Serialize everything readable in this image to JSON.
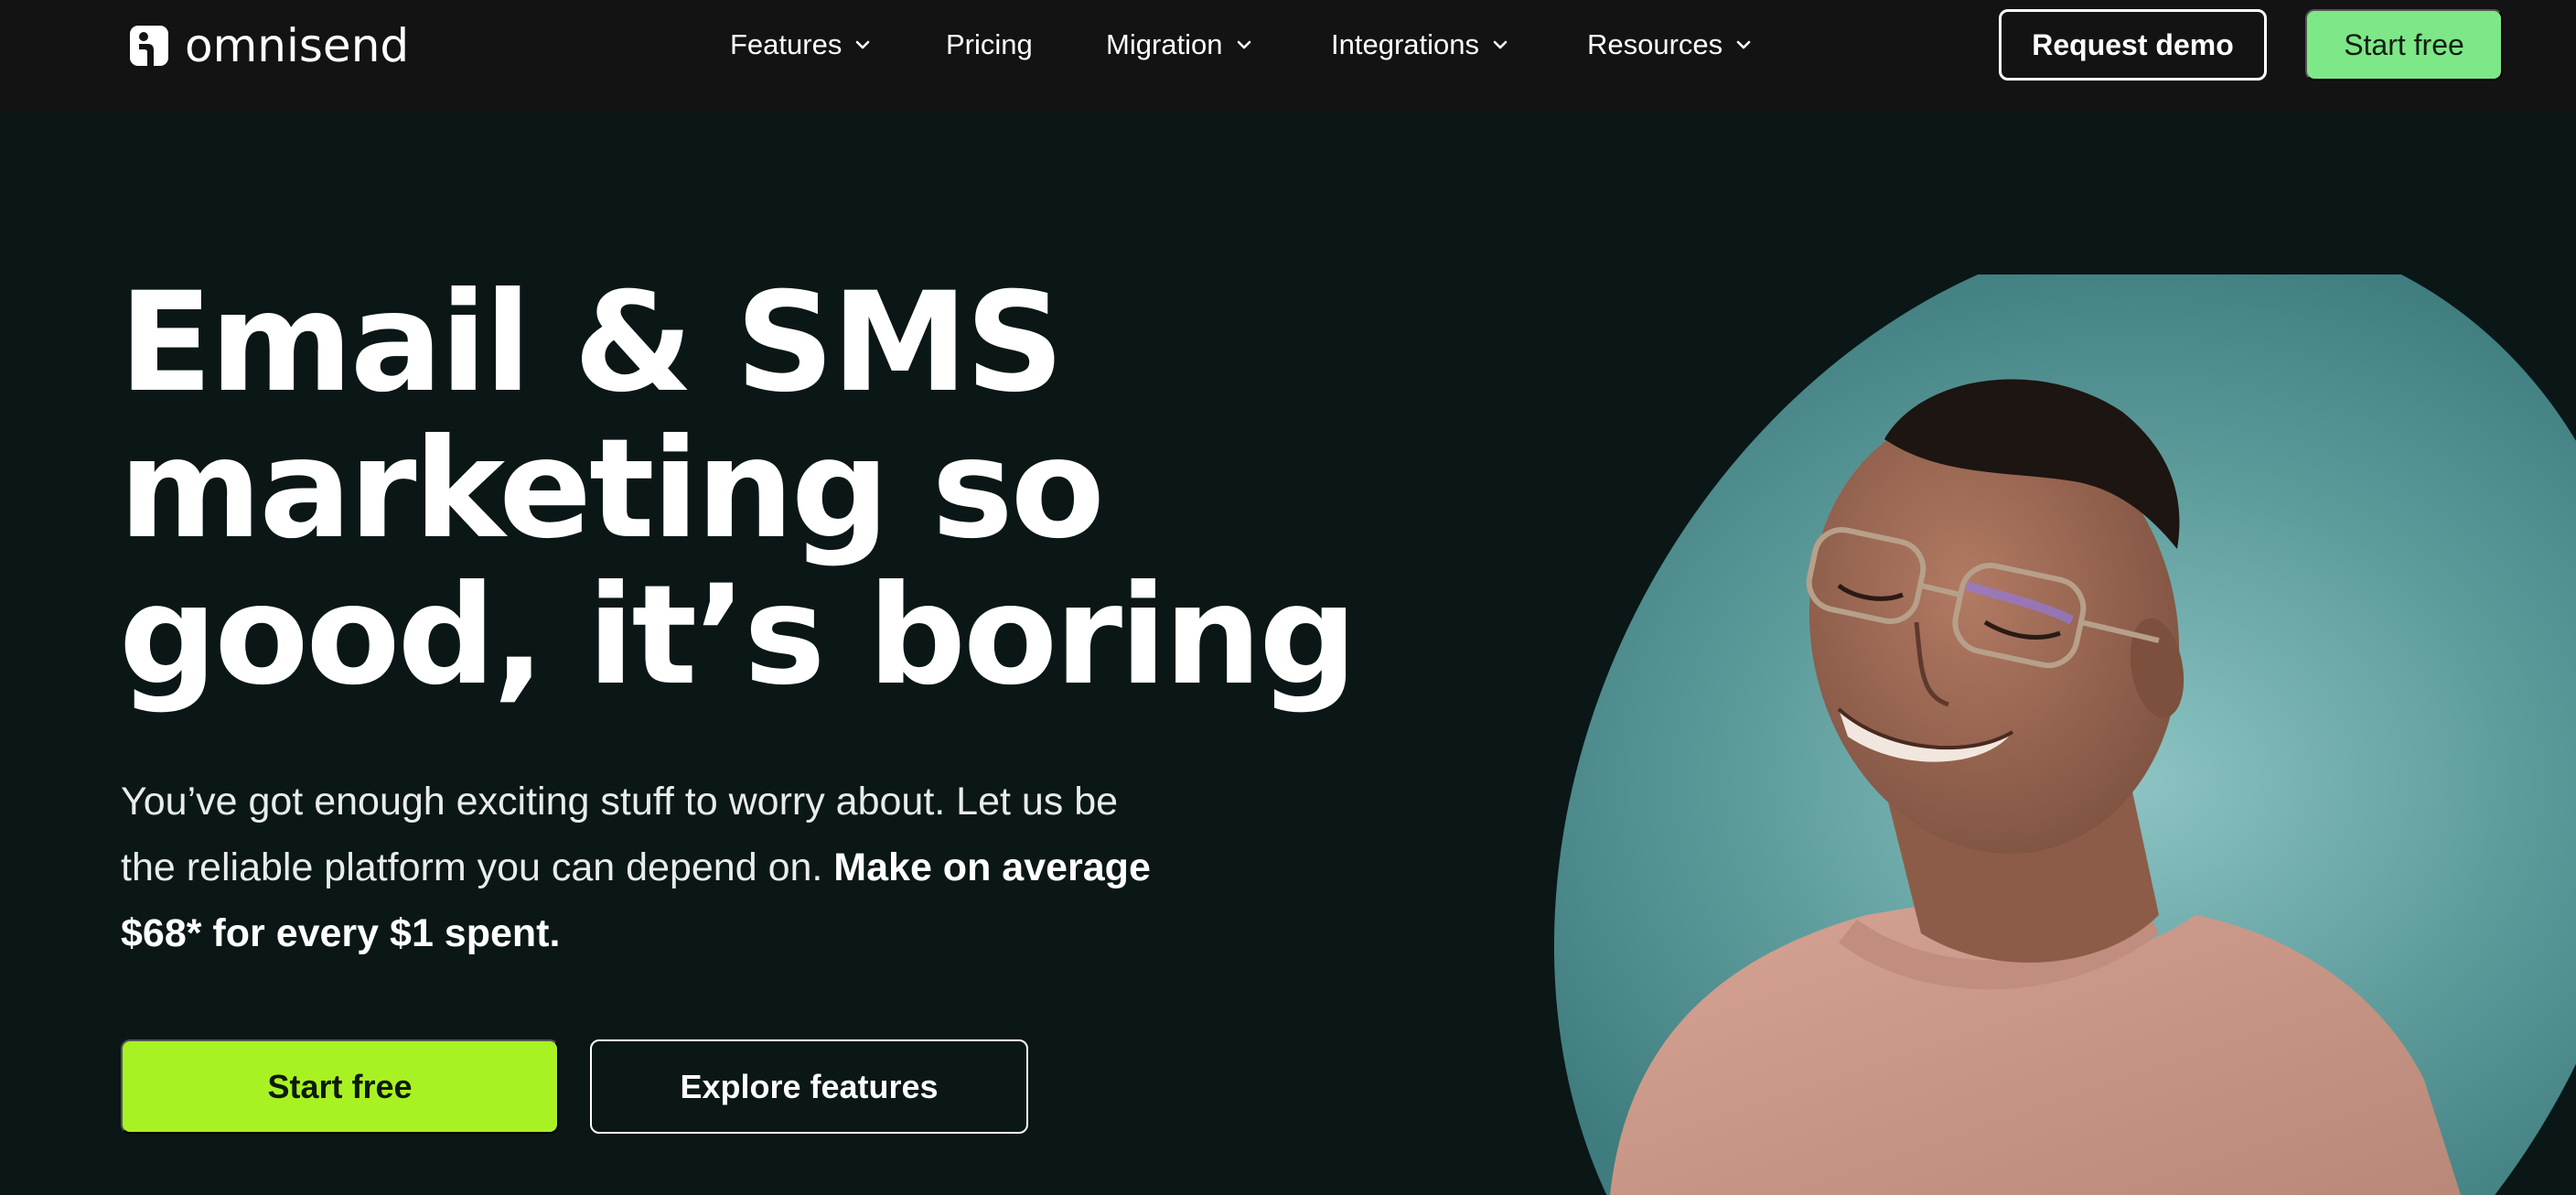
{
  "brand": {
    "name": "omnisend",
    "accent_nav_button": "#7ee787",
    "accent_hero_button": "#a8f224",
    "background": "#0a1716",
    "navbar_background": "#131313"
  },
  "nav": {
    "items": [
      {
        "label": "Features",
        "has_dropdown": true,
        "icon": "chevron-down-icon"
      },
      {
        "label": "Pricing",
        "has_dropdown": false
      },
      {
        "label": "Migration",
        "has_dropdown": true,
        "icon": "chevron-down-icon"
      },
      {
        "label": "Integrations",
        "has_dropdown": true,
        "icon": "chevron-down-icon"
      },
      {
        "label": "Resources",
        "has_dropdown": true,
        "icon": "chevron-down-icon"
      }
    ],
    "request_demo_label": "Request demo",
    "start_free_label": "Start free"
  },
  "hero": {
    "title_lines": [
      "Email & SMS",
      "marketing so",
      "good, it’s boring"
    ],
    "subtitle_regular": "You’ve got enough exciting stuff to worry about. Let us be the reliable platform you can depend on. ",
    "subtitle_bold": "Make on average $68* for every $1 spent.",
    "primary_cta": "Start free",
    "secondary_cta": "Explore features",
    "image_backdrop_color": "#5e9c9c"
  }
}
